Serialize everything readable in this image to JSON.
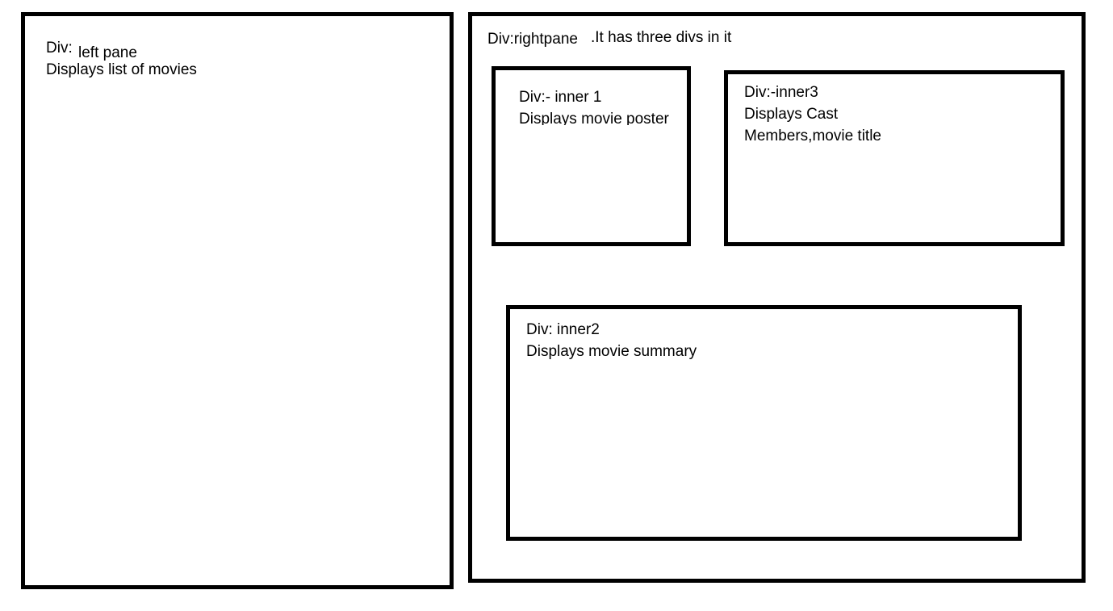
{
  "left_pane": {
    "prefix": "Div:",
    "name": "left pane",
    "description": "Displays list of movies"
  },
  "right_pane": {
    "title": "Div:rightpane",
    "note": ".It has three divs in it"
  },
  "inner1": {
    "title": "Div:- inner 1",
    "description": "Displays movie poster"
  },
  "inner3": {
    "title": "Div:-inner3",
    "description_line1": "Displays Cast",
    "description_line2": "Members,movie title"
  },
  "inner2": {
    "title": "Div: inner2",
    "description": "Displays movie summary"
  },
  "colors": {
    "border": "#000000",
    "background": "#ffffff",
    "text": "#000000"
  }
}
